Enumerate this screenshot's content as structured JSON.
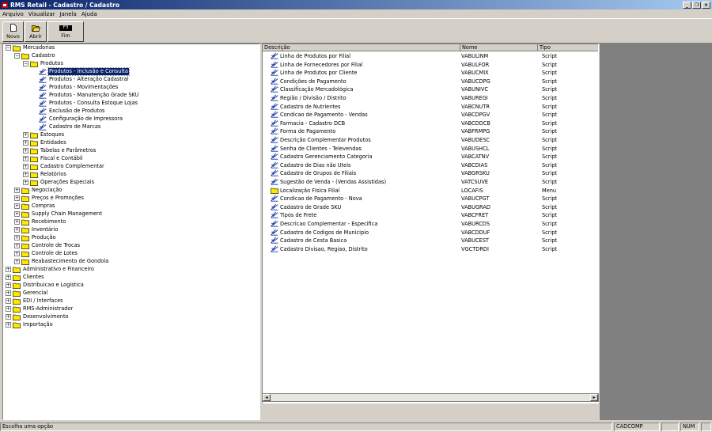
{
  "window": {
    "title": "RMS Retail - Cadastro / Cadastro"
  },
  "menu": [
    "Arquivo",
    "Visualizar",
    "Janela",
    "Ajuda"
  ],
  "toolbar": {
    "new_label": "Novo",
    "open_label": "Abrir",
    "end_key": "F3",
    "end_label": "Fim"
  },
  "tree": [
    {
      "label": "Mercadorias",
      "level": 0,
      "exp": "-",
      "icon": "folder"
    },
    {
      "label": "Cadastro",
      "level": 1,
      "exp": "-",
      "icon": "folder"
    },
    {
      "label": "Produtos",
      "level": 2,
      "exp": "-",
      "icon": "folder"
    },
    {
      "label": "Produtos - Inclusão e Consulta",
      "level": 3,
      "exp": "",
      "icon": "script",
      "selected": true
    },
    {
      "label": "Produtos - Alteração Cadastral",
      "level": 3,
      "exp": "",
      "icon": "script"
    },
    {
      "label": "Produtos - Movimentações",
      "level": 3,
      "exp": "",
      "icon": "script"
    },
    {
      "label": "Produtos - Manutenção Grade SKU",
      "level": 3,
      "exp": "",
      "icon": "script"
    },
    {
      "label": "Produtos - Consulta Estoque Lojas",
      "level": 3,
      "exp": "",
      "icon": "script"
    },
    {
      "label": "Exclusão de Produtos",
      "level": 3,
      "exp": "",
      "icon": "script"
    },
    {
      "label": "Configuração de Impressora",
      "level": 3,
      "exp": "",
      "icon": "script"
    },
    {
      "label": "Cadastro de Marcas",
      "level": 3,
      "exp": "",
      "icon": "script"
    },
    {
      "label": "Estoques",
      "level": 2,
      "exp": "+",
      "icon": "folder"
    },
    {
      "label": "Entidades",
      "level": 2,
      "exp": "+",
      "icon": "folder"
    },
    {
      "label": "Tabelas e Parâmetros",
      "level": 2,
      "exp": "+",
      "icon": "folder"
    },
    {
      "label": "Fiscal e Contábil",
      "level": 2,
      "exp": "+",
      "icon": "folder"
    },
    {
      "label": "Cadastro Complementar",
      "level": 2,
      "exp": "+",
      "icon": "folder"
    },
    {
      "label": "Relatórios",
      "level": 2,
      "exp": "+",
      "icon": "folder"
    },
    {
      "label": "Operações Especiais",
      "level": 2,
      "exp": "+",
      "icon": "folder"
    },
    {
      "label": "Negociação",
      "level": 1,
      "exp": "+",
      "icon": "folder"
    },
    {
      "label": "Preços e Promoções",
      "level": 1,
      "exp": "+",
      "icon": "folder"
    },
    {
      "label": "Compras",
      "level": 1,
      "exp": "+",
      "icon": "folder"
    },
    {
      "label": "Supply Chain Management",
      "level": 1,
      "exp": "+",
      "icon": "folder"
    },
    {
      "label": "Recebimento",
      "level": 1,
      "exp": "+",
      "icon": "folder"
    },
    {
      "label": "Inventário",
      "level": 1,
      "exp": "+",
      "icon": "folder"
    },
    {
      "label": "Produção",
      "level": 1,
      "exp": "+",
      "icon": "folder"
    },
    {
      "label": "Controle de Trocas",
      "level": 1,
      "exp": "+",
      "icon": "folder"
    },
    {
      "label": "Controle de Lotes",
      "level": 1,
      "exp": "+",
      "icon": "folder"
    },
    {
      "label": "Reabastecimento de Gondola",
      "level": 1,
      "exp": "+",
      "icon": "folder"
    },
    {
      "label": "Administrativo e Financeiro",
      "level": 0,
      "exp": "+",
      "icon": "folder"
    },
    {
      "label": "Clientes",
      "level": 0,
      "exp": "+",
      "icon": "folder"
    },
    {
      "label": "Distribuicao e Logistica",
      "level": 0,
      "exp": "+",
      "icon": "folder"
    },
    {
      "label": "Gerencial",
      "level": 0,
      "exp": "+",
      "icon": "folder"
    },
    {
      "label": "EDI / Interfaces",
      "level": 0,
      "exp": "+",
      "icon": "folder"
    },
    {
      "label": "RMS-Administrador",
      "level": 0,
      "exp": "+",
      "icon": "folder"
    },
    {
      "label": "Desenvolvimento",
      "level": 0,
      "exp": "+",
      "icon": "folder"
    },
    {
      "label": "Importação",
      "level": 0,
      "exp": "+",
      "icon": "folder"
    }
  ],
  "list": {
    "columns": [
      "Descrição",
      "Nome",
      "Tipo"
    ],
    "rows": [
      {
        "desc": "Linha de Produtos por Filial",
        "nome": "VABULINM",
        "tipo": "Script",
        "icon": "script"
      },
      {
        "desc": "Linha de Fornecedores por Filial",
        "nome": "VABULFOR",
        "tipo": "Script",
        "icon": "script"
      },
      {
        "desc": "Linha de Produtos por Cliente",
        "nome": "VABUCMIX",
        "tipo": "Script",
        "icon": "script"
      },
      {
        "desc": "Condições de Pagamento",
        "nome": "VABUCDPG",
        "tipo": "Script",
        "icon": "script"
      },
      {
        "desc": "Classificação Mercadológica",
        "nome": "VABUNIVC",
        "tipo": "Script",
        "icon": "script"
      },
      {
        "desc": "Região / Divisão / Distrito",
        "nome": "VABUREGI",
        "tipo": "Script",
        "icon": "script"
      },
      {
        "desc": "Cadastro de Nutrientes",
        "nome": "VABCNUTR",
        "tipo": "Script",
        "icon": "script"
      },
      {
        "desc": "Condicao de Pagamento - Vendas",
        "nome": "VABCDPGV",
        "tipo": "Script",
        "icon": "script"
      },
      {
        "desc": "Farmacia - Cadastro DCB",
        "nome": "VABCDDCB",
        "tipo": "Script",
        "icon": "script"
      },
      {
        "desc": "Forma de Pagamento",
        "nome": "VABFRMPG",
        "tipo": "Script",
        "icon": "script"
      },
      {
        "desc": "Descrição Complementar Produtos",
        "nome": "VABUDESC",
        "tipo": "Script",
        "icon": "script"
      },
      {
        "desc": "Senha de Clientes - Televendas",
        "nome": "VABUSHCL",
        "tipo": "Script",
        "icon": "script"
      },
      {
        "desc": "Cadastro Gerenciamento Categoria",
        "nome": "VABCATNV",
        "tipo": "Script",
        "icon": "script"
      },
      {
        "desc": "Cadastro de Dias não Uteis",
        "nome": "VABCDIAS",
        "tipo": "Script",
        "icon": "script"
      },
      {
        "desc": "Cadastro de Grupos de Filiais",
        "nome": "VABGRSKU",
        "tipo": "Script",
        "icon": "script"
      },
      {
        "desc": "Sugestão de Venda - (Vendas Assistidas)",
        "nome": "VATCSUVE",
        "tipo": "Script",
        "icon": "script"
      },
      {
        "desc": "Localização Física Filial",
        "nome": "LOCAFIS",
        "tipo": "Menu",
        "icon": "folder"
      },
      {
        "desc": "Condicao de Pagamento - Nova",
        "nome": "VABUCPGT",
        "tipo": "Script",
        "icon": "script"
      },
      {
        "desc": "Cadastro de Grade SKU",
        "nome": "VABUGRAD",
        "tipo": "Script",
        "icon": "script"
      },
      {
        "desc": "Tipos de Frete",
        "nome": "VABCFRET",
        "tipo": "Script",
        "icon": "script"
      },
      {
        "desc": "Descricao Complementar - Especifica",
        "nome": "VABURCDS",
        "tipo": "Script",
        "icon": "script"
      },
      {
        "desc": "Cadastro de Codigos de Municipio",
        "nome": "VABCDDUF",
        "tipo": "Script",
        "icon": "script"
      },
      {
        "desc": "Cadastro de Cesta Basica",
        "nome": "VABUCEST",
        "tipo": "Script",
        "icon": "script"
      },
      {
        "desc": "Cadastro Divisao, Regiao, Distrito",
        "nome": "VGCTDRDI",
        "tipo": "Script",
        "icon": "script"
      }
    ]
  },
  "status": {
    "message": "Escolha uma opção",
    "program": "CADCOMP",
    "num": "NUM"
  }
}
